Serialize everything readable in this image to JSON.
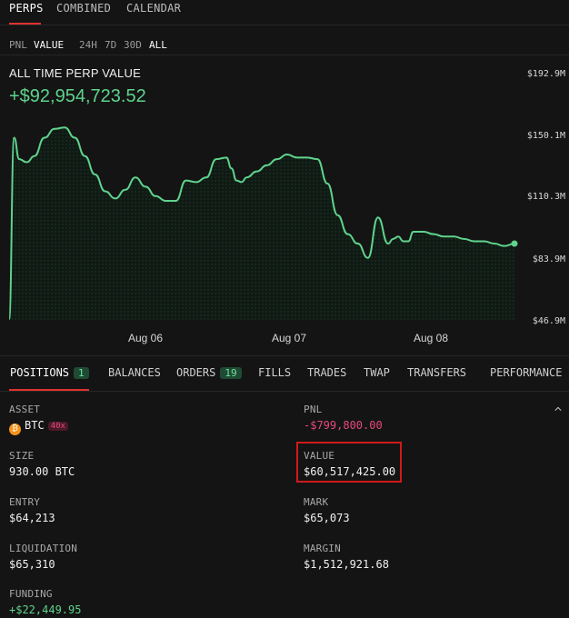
{
  "top_tabs": [
    "PERPS",
    "COMBINED",
    "CALENDAR"
  ],
  "view_toggle": [
    "PNL",
    "VALUE"
  ],
  "ranges": [
    "24H",
    "7D",
    "30D",
    "ALL"
  ],
  "chart_header": {
    "title": "ALL TIME PERP VALUE",
    "value": "+$92,954,723.52"
  },
  "chart_data": {
    "type": "area",
    "title": "ALL TIME PERP VALUE",
    "xlabel": "",
    "ylabel": "",
    "y_tick_labels": [
      "$192.9M",
      "$150.1M",
      "$110.3M",
      "$83.9M",
      "$46.9M"
    ],
    "x_tick_labels": [
      "Aug 06",
      "Aug 07",
      "Aug 08"
    ],
    "ylim": [
      46.9,
      192.9
    ],
    "grid": false,
    "series": [
      {
        "color": "#5fd38d",
        "t": [
          0.0,
          0.01,
          0.02,
          0.035,
          0.05,
          0.07,
          0.09,
          0.11,
          0.13,
          0.15,
          0.17,
          0.19,
          0.21,
          0.23,
          0.25,
          0.27,
          0.29,
          0.31,
          0.33,
          0.35,
          0.37,
          0.39,
          0.41,
          0.43,
          0.44,
          0.45,
          0.46,
          0.47,
          0.49,
          0.51,
          0.53,
          0.55,
          0.57,
          0.59,
          0.61,
          0.63,
          0.65,
          0.67,
          0.69,
          0.71,
          0.73,
          0.75,
          0.76,
          0.77,
          0.78,
          0.79,
          0.8,
          0.82,
          0.84,
          0.86,
          0.88,
          0.9,
          0.92,
          0.94,
          0.96,
          0.98,
          1.0
        ],
        "values": [
          47.5,
          148,
          134,
          132,
          136,
          148,
          154,
          155,
          148,
          136,
          124,
          113,
          109,
          114,
          122,
          116,
          110,
          108,
          108,
          120,
          119,
          122,
          134,
          135,
          128,
          120,
          119,
          122,
          126,
          130,
          134,
          137,
          135,
          135,
          134,
          118,
          102,
          94,
          90,
          84,
          101,
          90,
          92,
          93,
          91,
          91,
          95,
          95,
          94,
          93,
          93,
          92,
          91,
          91,
          90,
          89,
          90
        ]
      }
    ]
  },
  "bottom_tabs": [
    {
      "label": "POSITIONS",
      "badge": "1"
    },
    {
      "label": "BALANCES"
    },
    {
      "label": "ORDERS",
      "badge": "19"
    },
    {
      "label": "FILLS"
    },
    {
      "label": "TRADES"
    },
    {
      "label": "TWAP"
    },
    {
      "label": "TRANSFERS"
    },
    {
      "label": "PERFORMANCE"
    }
  ],
  "position": {
    "asset_label": "ASSET",
    "asset": "BTC",
    "coin_symbol": "₿",
    "leverage": "40x",
    "pnl_label": "PNL",
    "pnl": "-$799,800.00",
    "size_label": "SIZE",
    "size": "930.00 BTC",
    "value_label": "VALUE",
    "value": "$60,517,425.00",
    "entry_label": "ENTRY",
    "entry": "$64,213",
    "mark_label": "MARK",
    "mark": "$65,073",
    "liquidation_label": "LIQUIDATION",
    "liquidation": "$65,310",
    "margin_label": "MARGIN",
    "margin": "$1,512,921.68",
    "funding_label": "FUNDING",
    "funding": "+$22,449.95"
  },
  "colors": {
    "accent_red": "#e03131",
    "positive": "#5fd38d",
    "negative": "#e64a7a",
    "highlight": "#d11a1a"
  }
}
